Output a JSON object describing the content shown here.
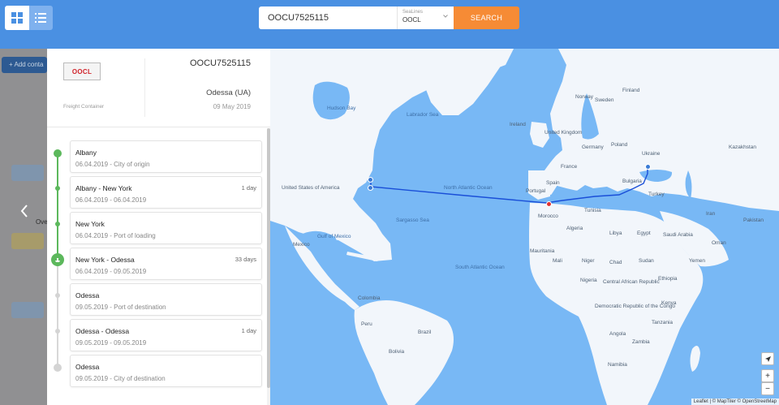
{
  "search": {
    "value": "OOCU7525115",
    "sealine_label": "SeaLines",
    "sealine_value": "OOCL",
    "button_label": "SEARCH"
  },
  "background": {
    "add_label": "+ Add conta",
    "over_label": "Ove"
  },
  "panel": {
    "logo_text": "OOCL",
    "freight_label": "Freight Container",
    "container_number": "OOCU7525115",
    "destination": "Odessa (UA)",
    "destination_date": "09 May 2019"
  },
  "steps": [
    {
      "title": "Albany",
      "subtitle": "06.04.2019 - City of origin",
      "duration": ""
    },
    {
      "title": "Albany - New York",
      "subtitle": "06.04.2019 - 06.04.2019",
      "duration": "1 day"
    },
    {
      "title": "New York",
      "subtitle": "06.04.2019 - Port of loading",
      "duration": ""
    },
    {
      "title": "New York - Odessa",
      "subtitle": "06.04.2019 - 09.05.2019",
      "duration": "33 days"
    },
    {
      "title": "Odessa",
      "subtitle": "09.05.2019 - Port of destination",
      "duration": ""
    },
    {
      "title": "Odessa - Odessa",
      "subtitle": "09.05.2019 - 09.05.2019",
      "duration": "1 day"
    },
    {
      "title": "Odessa",
      "subtitle": "09.05.2019 - City of destination",
      "duration": ""
    }
  ],
  "map": {
    "labels": {
      "hudson_bay": "Hudson Bay",
      "labrador_sea": "Labrador Sea",
      "united_states": "United States of America",
      "north_atlantic": "North Atlantic Ocean",
      "sargasso_sea": "Sargasso Sea",
      "gulf_of_mexico": "Gulf of Mexico",
      "mexico": "Mexico",
      "south_atlantic": "South Atlantic Ocean",
      "colombia": "Colombia",
      "peru": "Peru",
      "brazil": "Brazil",
      "bolivia": "Bolivia",
      "ireland": "Ireland",
      "united_kingdom": "United Kingdom",
      "norway": "Norway",
      "sweden": "Sweden",
      "finland": "Finland",
      "germany": "Germany",
      "france": "France",
      "spain": "Spain",
      "portugal": "Portugal",
      "poland": "Poland",
      "ukraine": "Ukraine",
      "bulgaria": "Bulgaria",
      "turkey": "Turkey",
      "kazakhstan": "Kazakhstan",
      "morocco": "Morocco",
      "algeria": "Algeria",
      "tunisia": "Tunisia",
      "libya": "Libya",
      "egypt": "Egypt",
      "iran": "Iran",
      "saudi_arabia": "Saudi Arabia",
      "mauritania": "Mauritania",
      "mali": "Mali",
      "niger": "Niger",
      "chad": "Chad",
      "sudan": "Sudan",
      "ethiopia": "Ethiopia",
      "nigeria": "Nigeria",
      "car": "Central African Republic",
      "kenya": "Kenya",
      "drc": "Democratic Republic of the Congo",
      "angola": "Angola",
      "tanzania": "Tanzania",
      "pakistan": "Pakistan",
      "oman": "Oman",
      "yemen": "Yemen",
      "namibia": "Namibia",
      "zambia": "Zambia"
    },
    "attribution": "Leaflet | © MapTiler © OpenStreetMap",
    "zoom_in": "+",
    "zoom_out": "−"
  },
  "colors": {
    "accent": "#4a90e2",
    "search_button": "#f68b35",
    "route": "#1a4fd8",
    "completed": "#5cb85c",
    "ocean": "#78b8f5"
  }
}
